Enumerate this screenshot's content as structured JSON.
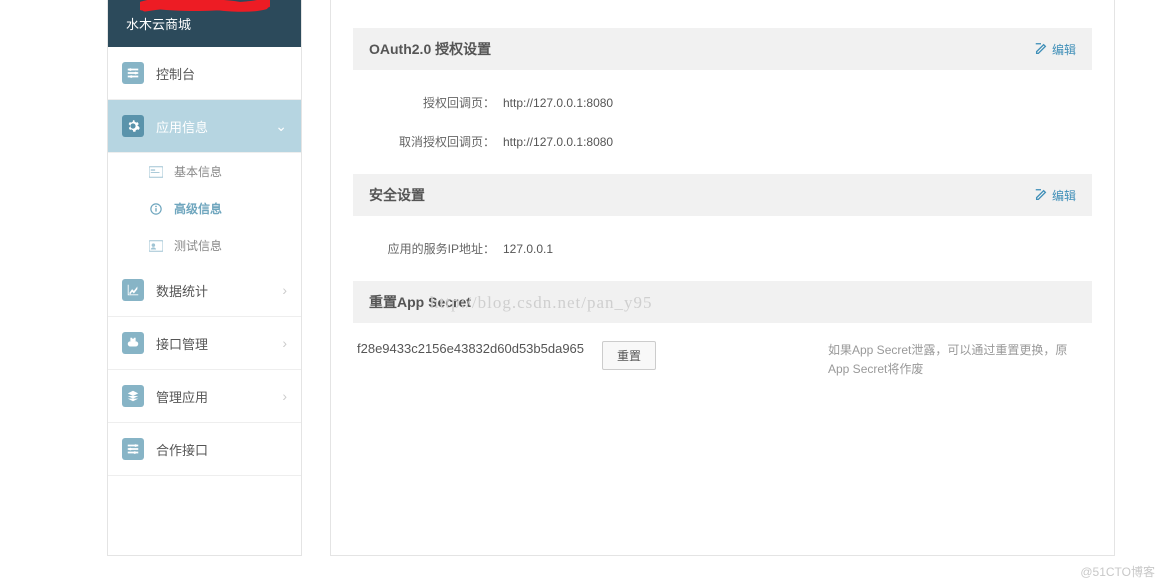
{
  "sidebar": {
    "header": "水木云商城",
    "items": [
      {
        "label": "控制台",
        "icon": "sliders"
      },
      {
        "label": "应用信息",
        "icon": "gear",
        "expanded": true
      },
      {
        "label": "数据统计",
        "icon": "chart"
      },
      {
        "label": "接口管理",
        "icon": "plug"
      },
      {
        "label": "管理应用",
        "icon": "stack"
      },
      {
        "label": "合作接口",
        "icon": "sliders"
      }
    ],
    "subitems": [
      {
        "label": "基本信息",
        "icon": "card"
      },
      {
        "label": "高级信息",
        "icon": "info",
        "selected": true
      },
      {
        "label": "测试信息",
        "icon": "user"
      }
    ]
  },
  "sections": {
    "oauth": {
      "title": "OAuth2.0 授权设置",
      "edit": "编辑",
      "callback_label": "授权回调页：",
      "callback_value": "http://127.0.0.1:8080",
      "cancel_label": "取消授权回调页：",
      "cancel_value": "http://127.0.0.1:8080"
    },
    "security": {
      "title": "安全设置",
      "edit": "编辑",
      "ip_label": "应用的服务IP地址：",
      "ip_value": "127.0.0.1"
    },
    "secret": {
      "title": "重置App Secret",
      "value": "f28e9433c2156e43832d60d53b5da965",
      "reset_btn": "重置",
      "note": "如果App Secret泄露，可以通过重置更换，原App Secret将作废"
    }
  },
  "watermark": "http://blog.csdn.net/pan_y95",
  "footer": "@51CTO博客"
}
